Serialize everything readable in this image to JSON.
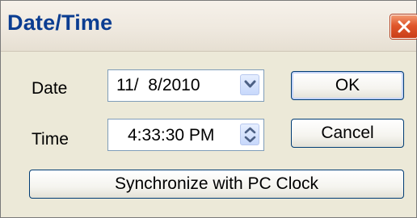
{
  "dialog": {
    "title": "Date/Time",
    "close_icon": "close-icon"
  },
  "date": {
    "label": "Date",
    "value": "11/  8/2010",
    "dropdown_icon": "chevron-down-icon"
  },
  "time": {
    "label": "Time",
    "value": "4:33:30 PM",
    "spinner_icon": "up-down-spinner-icon"
  },
  "buttons": {
    "ok": "OK",
    "cancel": "Cancel",
    "sync": "Synchronize with PC Clock"
  },
  "colors": {
    "title_text": "#0b3d91",
    "close_button": "#e0562b",
    "dialog_background": "#ece9d8",
    "field_border": "#7f9db9",
    "button_border": "#003c74"
  }
}
